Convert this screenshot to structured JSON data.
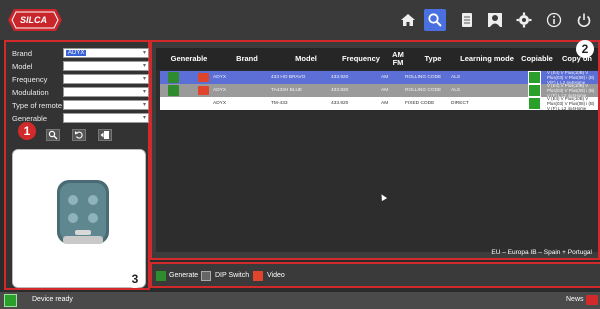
{
  "toolbar": {
    "logo_text": "SILCA",
    "buttons": [
      "home-icon",
      "search-icon",
      "database-icon",
      "user-icon",
      "gear-icon",
      "info-icon",
      "power-icon"
    ]
  },
  "filters": {
    "brand_label": "Brand",
    "brand_value": "ADYX",
    "model_label": "Model",
    "frequency_label": "Frequency",
    "modulation_label": "Modulation",
    "type_label": "Type of remote",
    "generable_label": "Generable"
  },
  "table": {
    "headers": {
      "generable": "Generable",
      "brand": "Brand",
      "model": "Model",
      "frequency": "Frequency",
      "amfm": "AM FM",
      "type": "Type",
      "learning": "Learning mode",
      "copiable": "Copiable",
      "copyon": "Copy on"
    },
    "rows": [
      {
        "brand": "ADYX",
        "model": "433 HO BRAVO",
        "frequency": "433.920",
        "amfm": "AM",
        "type": "ROLLING CODE",
        "learning": "ALS",
        "copyon": "V (E4) V Plus(10B) V Plus(03) V Plus(08) i (B) V(F) L L2 4x4Home"
      },
      {
        "brand": "ADYX",
        "model": "TA433H BLUE",
        "frequency": "433.920",
        "amfm": "AM",
        "type": "ROLLING CODE",
        "learning": "ALS",
        "copyon": "V (E4) V Plus(10B) V Plus(03) V Plus(08) i (B) V (F) L L2 4x4Home"
      },
      {
        "brand": "ADYX",
        "model": "TM-433",
        "frequency": "433.920",
        "amfm": "AM",
        "type": "FIXED CODE",
        "learning": "DIRECT",
        "copyon": "V (E4) V Plus(10B) V Plus(03) V Plus(08) i (B) V (F) L L2 4x4Home"
      }
    ]
  },
  "region_text": "EU – Europa   IB – Spain + Portugal",
  "legend": {
    "generate": "Generate",
    "dip": "DIP Switch",
    "video": "Video"
  },
  "status": {
    "text": "Device ready",
    "news": "News"
  },
  "callouts": {
    "one": "1",
    "two": "2",
    "three": "3"
  },
  "colors": {
    "accent": "#d22a2a",
    "selected_row": "#5b6fd6",
    "active_tool": "#4a6fe0",
    "ok": "#2aa02a"
  }
}
